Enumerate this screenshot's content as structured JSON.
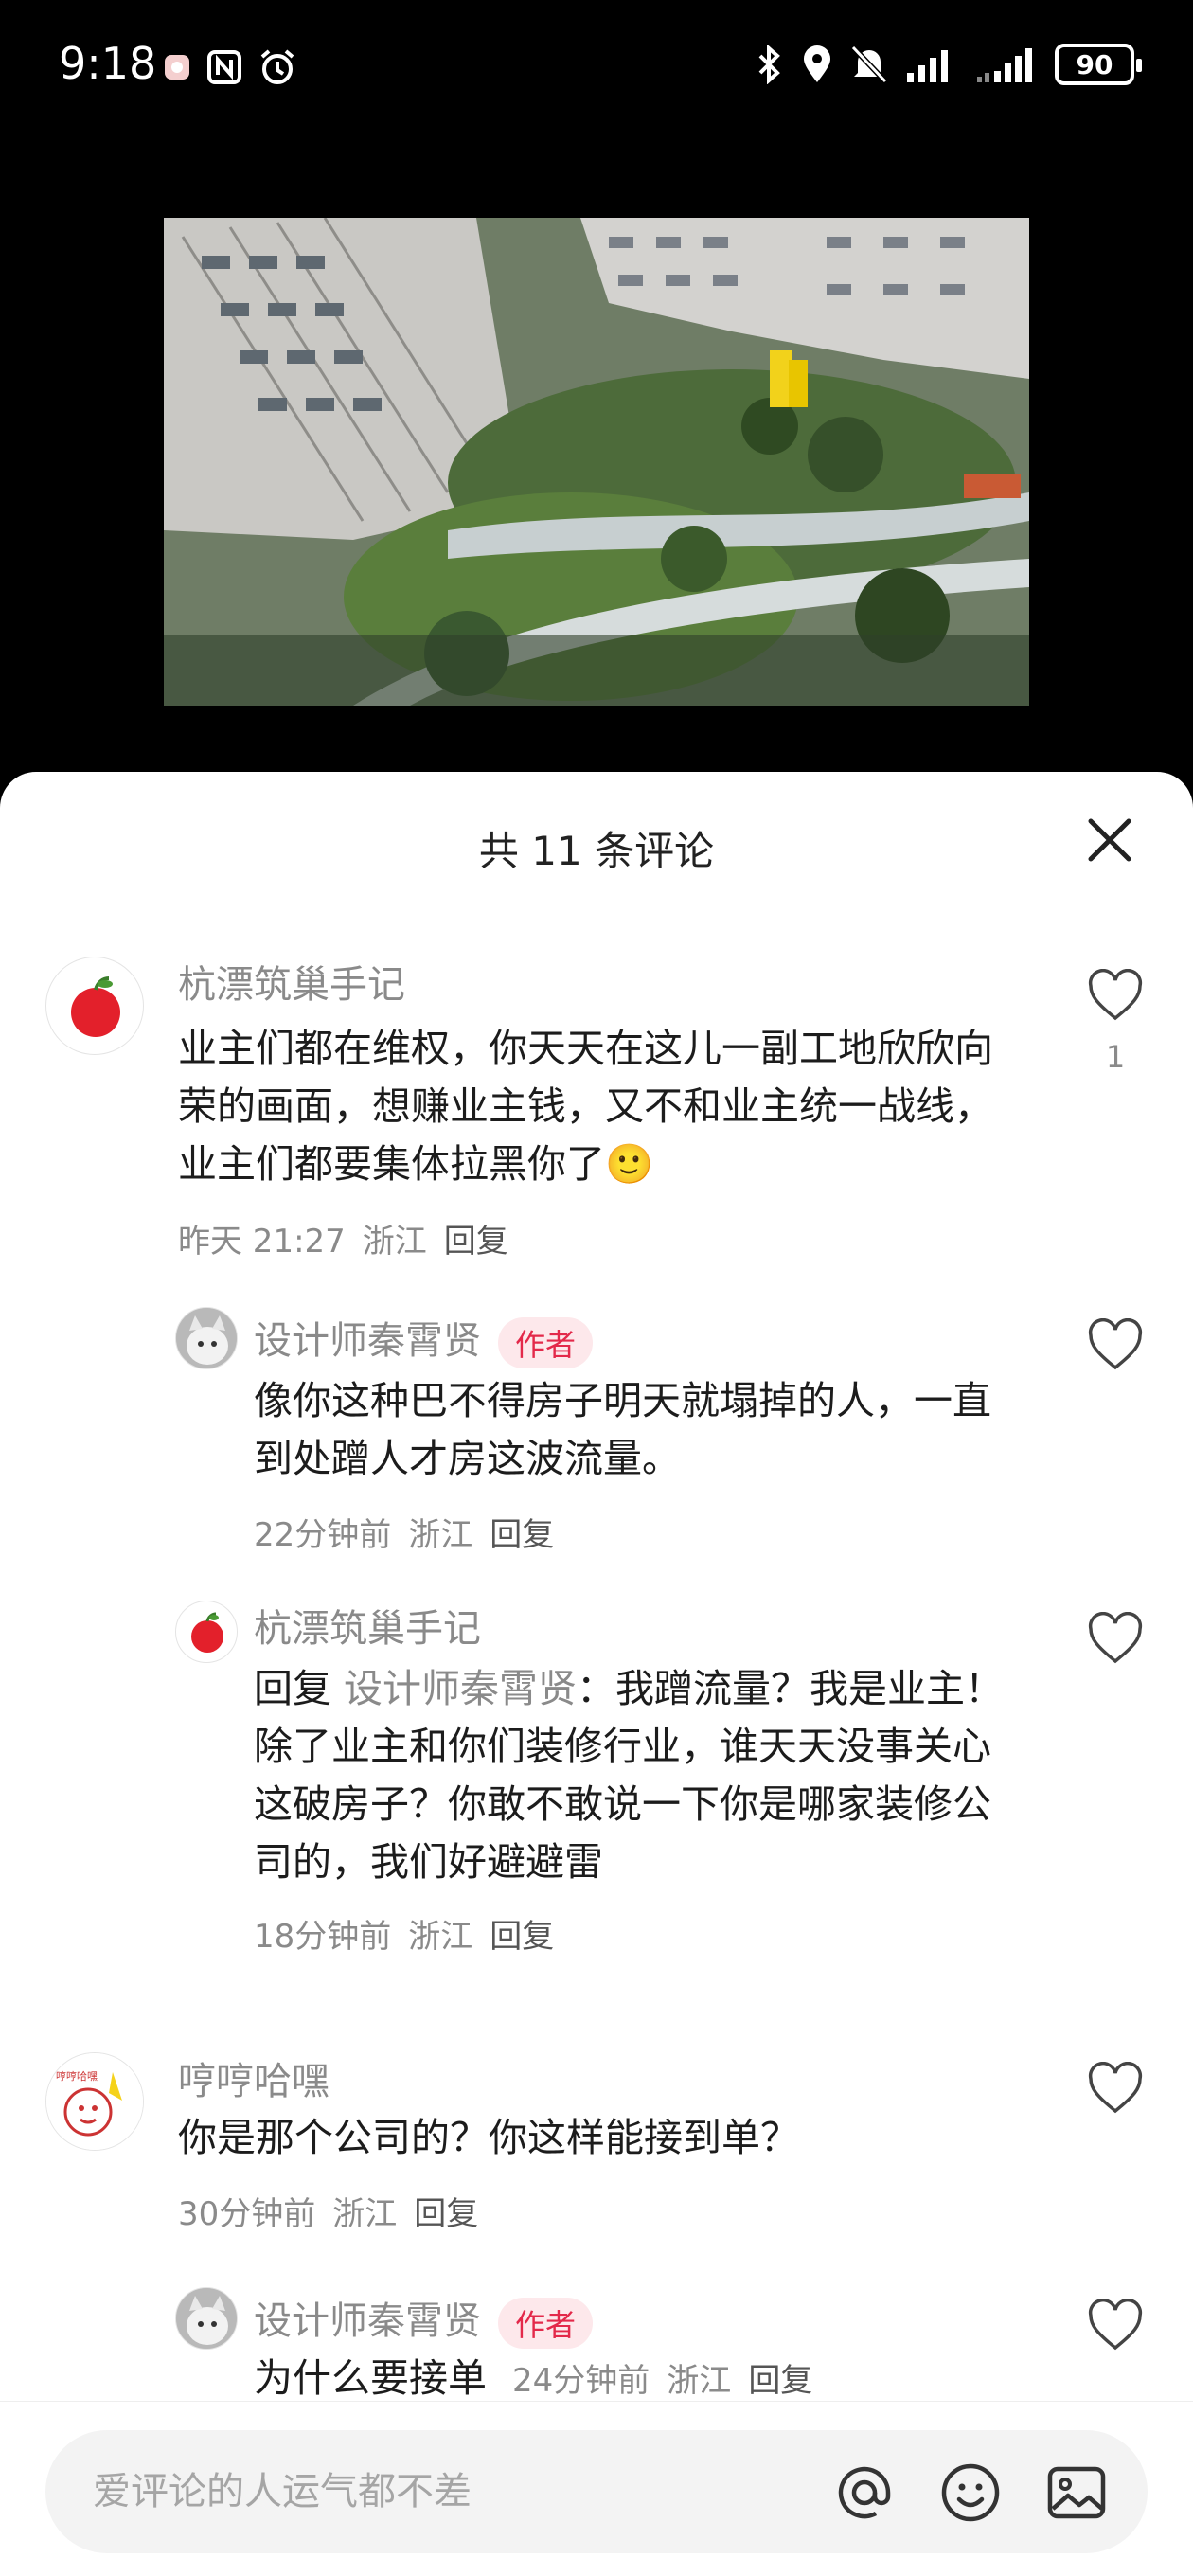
{
  "status": {
    "time": "9:18",
    "battery": "90"
  },
  "sheet": {
    "title": "共 11 条评论"
  },
  "comments": [
    {
      "name": "杭漂筑巢手记",
      "text": "业主们都在维权，你天天在这儿一副工地欣欣向荣的画面，想赚业主钱，又不和业主统一战线，业主们都要集体拉黑你了🙂",
      "time": "昨天 21:27",
      "location": "浙江",
      "reply": "回复",
      "likes": "1"
    },
    {
      "name": "设计师秦霄贤",
      "badge": "作者",
      "text": "像你这种巴不得房子明天就塌掉的人，一直到处蹭人才房这波流量。",
      "time": "22分钟前",
      "location": "浙江",
      "reply": "回复"
    },
    {
      "name": "杭漂筑巢手记",
      "reply_prefix": "回复",
      "reply_to": "设计师秦霄贤",
      "text": "：我蹭流量？我是业主！除了业主和你们装修行业，谁天天没事关心这破房子？你敢不敢说一下你是哪家装修公司的，我们好避避雷",
      "time": "18分钟前",
      "location": "浙江",
      "reply": "回复"
    },
    {
      "name": "哼哼哈嘿",
      "text": "你是那个公司的？你这样能接到单？",
      "time": "30分钟前",
      "location": "浙江",
      "reply": "回复"
    },
    {
      "name": "设计师秦霄贤",
      "badge": "作者",
      "text": "为什么要接单",
      "time": "24分钟前",
      "location": "浙江",
      "reply": "回复"
    }
  ],
  "input": {
    "placeholder": "爱评论的人运气都不差"
  },
  "icons": {
    "close": "close-icon",
    "like": "heart-outline-icon",
    "mention": "at-icon",
    "emoji": "smile-icon",
    "image": "image-icon"
  }
}
